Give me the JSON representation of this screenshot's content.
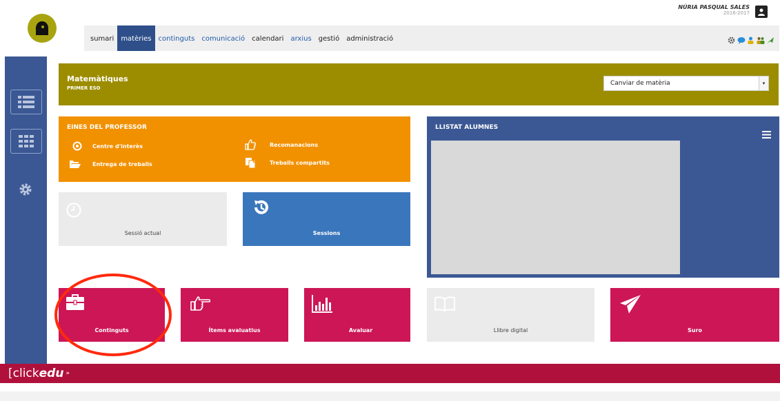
{
  "user": {
    "name": "NÚRIA PASQUAL SALES",
    "year": "2016-2017"
  },
  "nav": {
    "tabs": [
      {
        "label": "sumari"
      },
      {
        "label": "matèries"
      },
      {
        "label": "continguts"
      },
      {
        "label": "comunicació"
      },
      {
        "label": "calendari"
      },
      {
        "label": "arxius"
      },
      {
        "label": "gestió"
      },
      {
        "label": "administració"
      }
    ],
    "active_tab": "matèries",
    "icons": [
      "gear-icon",
      "chat-icon",
      "person-icon",
      "group-icon",
      "bird-icon"
    ]
  },
  "subject": {
    "title": "Matemàtiques",
    "subtitle": "PRIMER ESO",
    "select_value": "Canviar de matèria"
  },
  "tools": {
    "title": "EINES DEL PROFESSOR",
    "items": [
      {
        "label": "Centre d'interès",
        "icon": "target-icon"
      },
      {
        "label": "Entrega de treballs",
        "icon": "folder-open-icon"
      },
      {
        "label": "Recomanacions",
        "icon": "thumbs-up-icon"
      },
      {
        "label": "Treballs compartits",
        "icon": "shared-docs-icon"
      }
    ]
  },
  "students": {
    "title": "LLISTAT ALUMNES"
  },
  "tiles": {
    "current_session": "Sessió actual",
    "sessions": "Sessions",
    "contents": "Continguts",
    "items": "Ítems avaluatius",
    "evaluate": "Avaluar",
    "digital_book": "Llibre digital",
    "suro": "Suro"
  },
  "footer": {
    "logo_prefix": "[click",
    "logo_brand": "edu"
  },
  "colors": {
    "olive": "#9c8d00",
    "orange": "#f29100",
    "navy": "#3b5894",
    "blue": "#3a76bb",
    "magenta": "#cc1655",
    "footer": "#b0103c",
    "annotation": "#ff2a0d"
  }
}
